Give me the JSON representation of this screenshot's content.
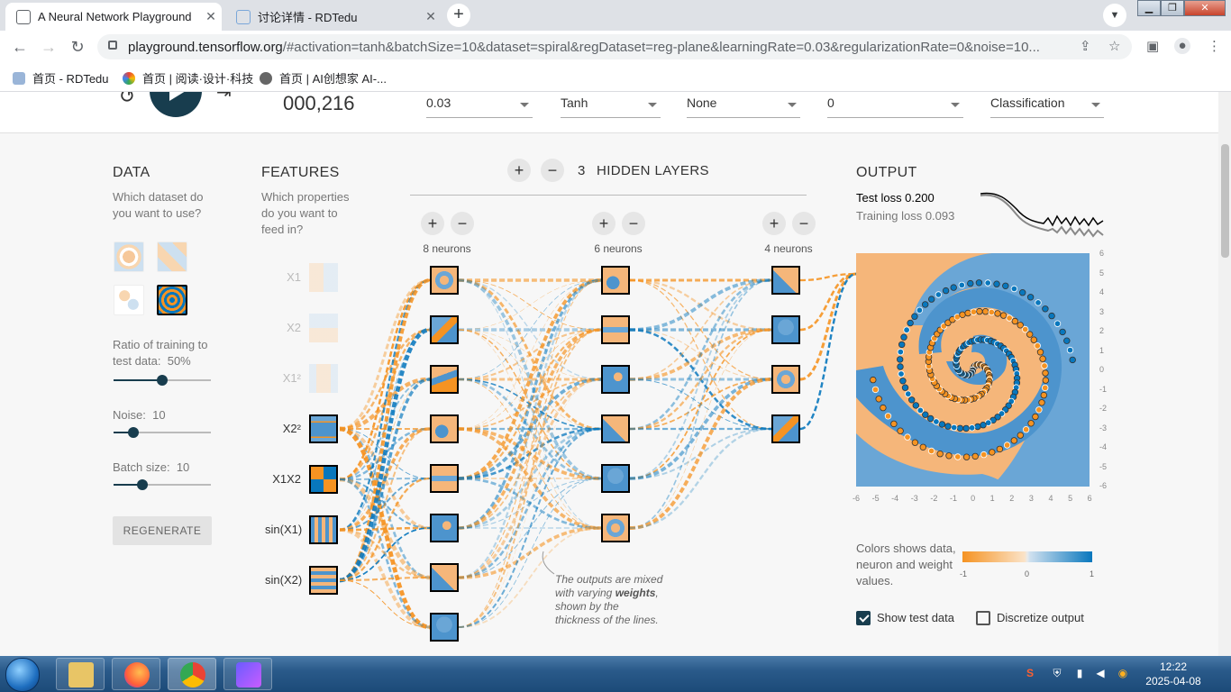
{
  "browser": {
    "tabs": [
      {
        "title": "A Neural Network Playground",
        "active": true
      },
      {
        "title": "讨论详情 - RDTedu",
        "active": false
      }
    ],
    "new_tab": "+",
    "url_host": "playground.tensorflow.org",
    "url_rest": "/#activation=tanh&batchSize=10&dataset=spiral&regDataset=reg-plane&learningRate=0.03&regularizationRate=0&noise=10...",
    "bookmarks": [
      "首页 - RDTedu",
      "首页 | 阅读·设计·科技",
      "首页 | AI创想家 AI-..."
    ]
  },
  "controls": {
    "epoch": "000,216",
    "learning_rate": "0.03",
    "activation": "Tanh",
    "regularization": "None",
    "regularization_rate": "0",
    "problem_type": "Classification"
  },
  "data_panel": {
    "title": "DATA",
    "question": "Which dataset do you want to use?",
    "ratio_label": "Ratio of training to test data:",
    "ratio_value": "50%",
    "noise_label": "Noise:",
    "noise_value": "10",
    "batch_label": "Batch size:",
    "batch_value": "10",
    "regenerate": "REGENERATE",
    "sliders": {
      "ratio": 0.5,
      "noise": 0.2,
      "batch": 0.3
    }
  },
  "features_panel": {
    "title": "FEATURES",
    "question": "Which properties do you want to feed in?",
    "features": [
      {
        "label": "X1",
        "active": false
      },
      {
        "label": "X2",
        "active": false
      },
      {
        "label": "X1²",
        "active": false
      },
      {
        "label": "X2²",
        "active": true
      },
      {
        "label": "X1X2",
        "active": true
      },
      {
        "label": "sin(X1)",
        "active": true
      },
      {
        "label": "sin(X2)",
        "active": true
      }
    ]
  },
  "network": {
    "hidden_count": "3",
    "hidden_label": "HIDDEN LAYERS",
    "layers": [
      {
        "label": "8 neurons",
        "count": 8
      },
      {
        "label": "6 neurons",
        "count": 6
      },
      {
        "label": "4 neurons",
        "count": 4
      }
    ],
    "plus": "+",
    "minus": "−",
    "callout_1": "The outputs are mixed with varying ",
    "callout_bold": "weights",
    "callout_2": ", shown by the thickness of the lines."
  },
  "output_panel": {
    "title": "OUTPUT",
    "test_loss": "Test loss 0.200",
    "training_loss": "Training loss 0.093",
    "colors_desc": "Colors shows data, neuron and weight values.",
    "colorbar_ticks": [
      "-1",
      "0",
      "1"
    ],
    "show_test_data": "Show test data",
    "discretize_output": "Discretize output",
    "x_ticks": [
      "-6",
      "-5",
      "-4",
      "-3",
      "-2",
      "-1",
      "0",
      "1",
      "2",
      "3",
      "4",
      "5",
      "6"
    ],
    "y_ticks": [
      "6",
      "5",
      "4",
      "3",
      "2",
      "1",
      "0",
      "-1",
      "-2",
      "-3",
      "-4",
      "-5",
      "-6"
    ]
  },
  "colors": {
    "orange": "#f59322",
    "blue": "#0877bd",
    "dark": "#183d4e"
  },
  "taskbar": {
    "time": "12:22",
    "date": "2025-04-08"
  }
}
